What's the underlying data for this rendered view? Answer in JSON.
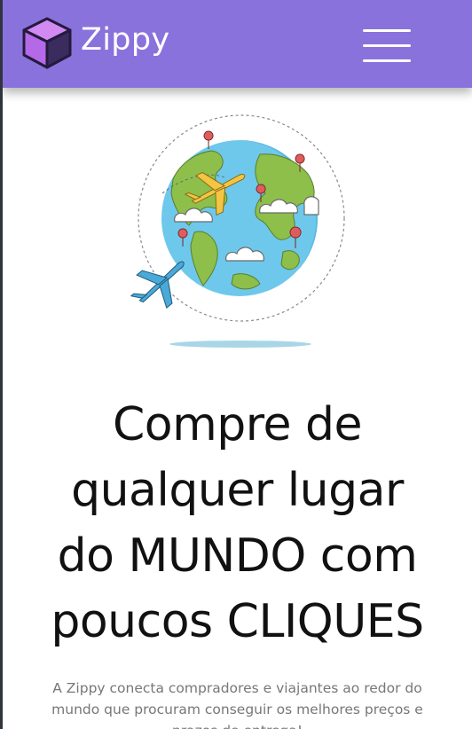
{
  "header": {
    "brand": "Zippy",
    "logo_icon": "cube-icon",
    "menu_icon": "hamburger-menu-icon",
    "colors": {
      "navbar": "#8a72dc",
      "cube_light": "#b46ae8",
      "cube_dark": "#2a1f47"
    }
  },
  "hero": {
    "illustration": "globe-with-airplanes-icon",
    "headline": {
      "line1": "Compre de",
      "line2": "qualquer lugar",
      "line3": "do MUNDO com",
      "line4": "poucos CLIQUES"
    },
    "description": "A Zippy conecta compradores e viajantes ao redor do mundo que procuram conseguir os melhores preços e prazos de entrega!"
  }
}
